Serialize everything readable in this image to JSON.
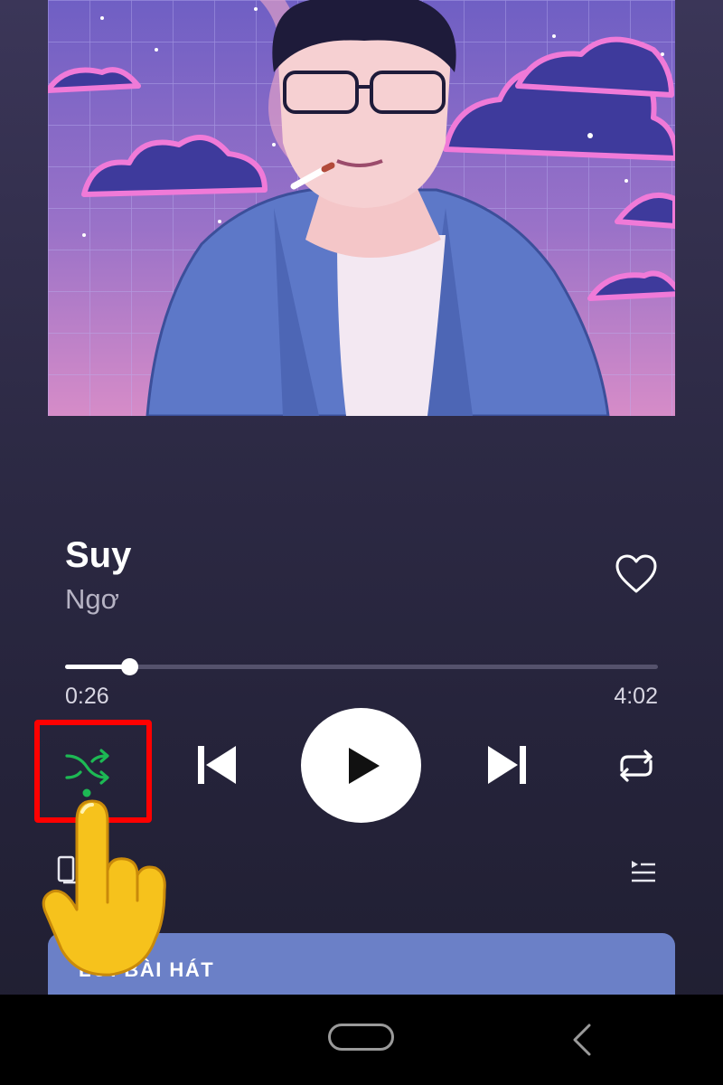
{
  "album_art": {
    "alt": "album-art"
  },
  "track": {
    "title": "Suy",
    "artist": "Ngơ"
  },
  "progress": {
    "elapsed": "0:26",
    "total": "4:02",
    "fraction": 0.108
  },
  "controls": {
    "shuffle": {
      "icon": "shuffle-icon",
      "active": true,
      "color": "#1db954"
    },
    "previous": {
      "icon": "skip-previous-icon"
    },
    "play": {
      "icon": "play-icon"
    },
    "next": {
      "icon": "skip-next-icon"
    },
    "repeat": {
      "icon": "repeat-icon"
    }
  },
  "secondary": {
    "devices_icon": "devices-icon",
    "queue_icon": "queue-icon"
  },
  "lyrics": {
    "label": "LỜI BÀI HÁT"
  },
  "annotation": {
    "highlight_color": "#ff0000"
  },
  "colors": {
    "accent": "#1db954",
    "lyrics_card": "#6b80c7"
  }
}
